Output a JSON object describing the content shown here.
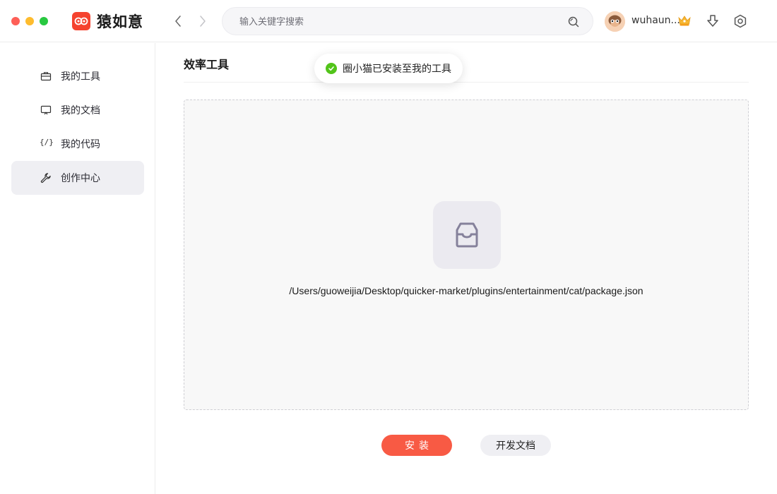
{
  "app": {
    "name": "猿如意"
  },
  "search": {
    "placeholder": "输入关键字搜索"
  },
  "user": {
    "name": "wuhaun..."
  },
  "sidebar": {
    "items": [
      {
        "label": "我的工具",
        "icon": "briefcase-icon"
      },
      {
        "label": "我的文档",
        "icon": "monitor-icon"
      },
      {
        "label": "我的代码",
        "icon": "code-icon",
        "glyph": "{/}"
      },
      {
        "label": "创作中心",
        "icon": "wrench-icon",
        "active": true
      }
    ]
  },
  "main": {
    "title": "效率工具",
    "toast": "圈小猫已安装至我的工具",
    "path": "/Users/guoweijia/Desktop/quicker-market/plugins/entertainment/cat/package.json",
    "install_label": "安装",
    "docs_label": "开发文档"
  },
  "colors": {
    "brand": "#f5432f",
    "install": "#f85a44",
    "success": "#52c41a",
    "active_bg": "#efeff3"
  }
}
